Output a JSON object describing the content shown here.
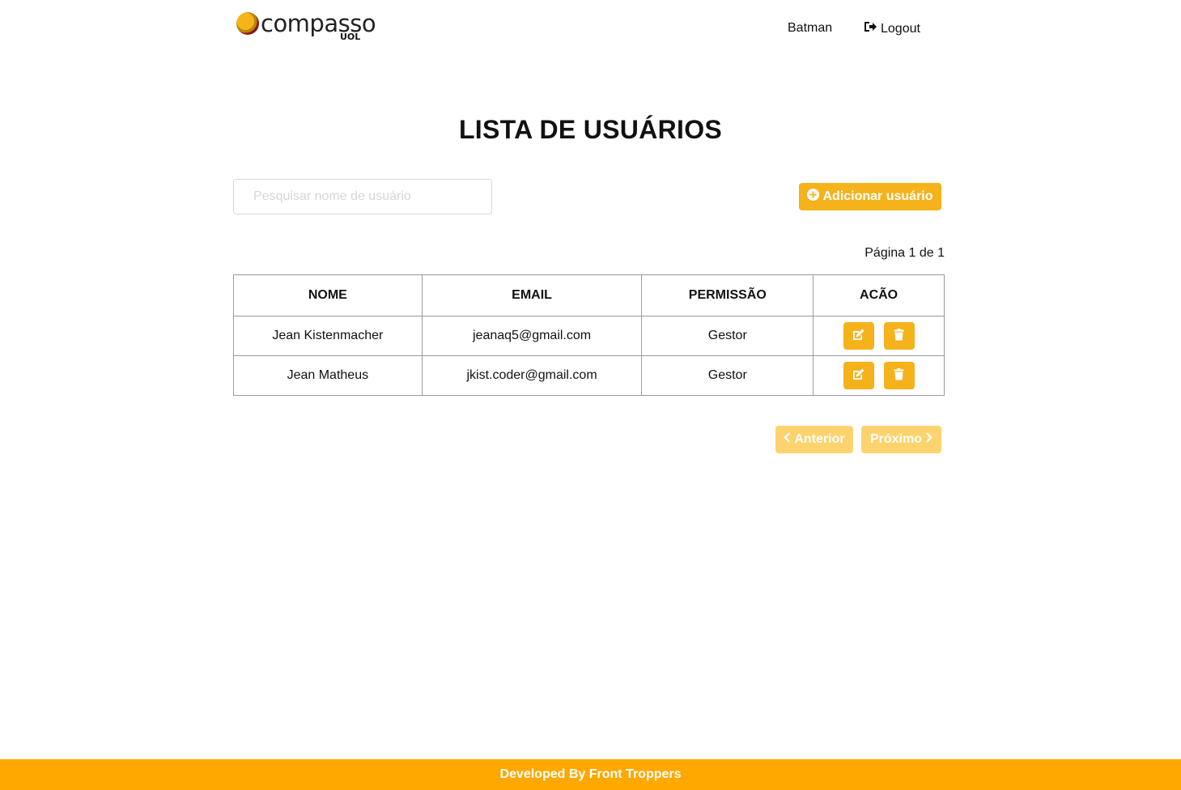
{
  "header": {
    "logo_text": "compasso",
    "logo_sub": "UOL",
    "user_name": "Batman",
    "logout_label": "Logout"
  },
  "main": {
    "title": "LISTA DE USUÁRIOS",
    "search_placeholder": "Pesquisar nome de usuário",
    "add_user_label": "Adicionar usuário",
    "page_info": "Página 1 de 1",
    "columns": [
      "NOME",
      "EMAIL",
      "PERMISSÃO",
      "ACÃO"
    ],
    "rows": [
      {
        "nome": "Jean Kistenmacher",
        "email": "jeanaq5@gmail.com",
        "permissao": "Gestor"
      },
      {
        "nome": "Jean Matheus",
        "email": "jkist.coder@gmail.com",
        "permissao": "Gestor"
      }
    ],
    "prev_label": "Anterior",
    "next_label": "Próximo"
  },
  "footer": {
    "text": "Developed By Front Troppers"
  },
  "icons": {
    "logout": "sign-out-icon",
    "add": "plus-circle-icon",
    "edit": "edit-icon",
    "delete": "trash-icon",
    "prev": "chevron-left-icon",
    "next": "chevron-right-icon"
  },
  "colors": {
    "accent": "#f5b21b",
    "accent_disabled": "#fdd36d",
    "footer": "#ffa800"
  }
}
